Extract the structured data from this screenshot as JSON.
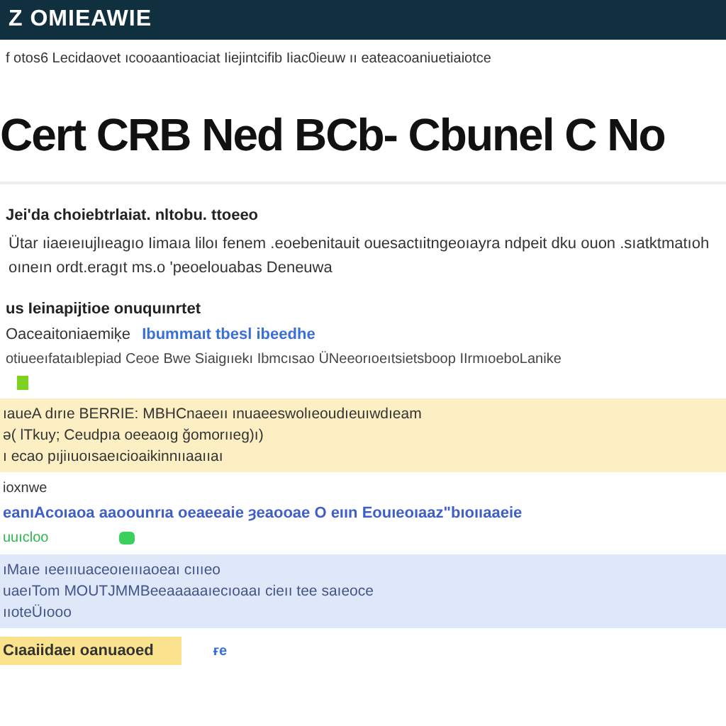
{
  "header": {
    "title": "Z OMIEAWIE"
  },
  "breadcrumb": "f otos6 Lecidaovet ıcooaantioaciat Iiejintcifib Iiac0ieuw ıı eateacoaniuetiaiotce",
  "heading": "Cert CRB Ned BCb- Cbunel C No",
  "blocks": [
    {
      "kind": "heading",
      "text": "Jei'da choiebtrlaiat. nltobu. ttoeeo"
    },
    {
      "kind": "paragraph",
      "text": "Ütar ıiaeıeıujlıeagıo Iimaıa liloı fenem .eoebenitauit ouesactıitngeoıayra ndpeit dku ouon .sıatktmatıoh oıneın ordt.eragıt ms.o 'peoelouabas Deneuwa"
    },
    {
      "kind": "heading",
      "text": "us Ieinapijtioe onuquınrtet"
    },
    {
      "kind": "link_line",
      "text": "Oaceaitoniaemiķe",
      "link": "Ibummaıt tbesl ibeedhe"
    },
    {
      "kind": "meta",
      "text": "otiueeıfataıblepiad Ceoe Bwe Siaigııekı Ibmcısao ÜNeeorıoeıtsietsboop IIrmıoeboLanike"
    },
    {
      "kind": "marker",
      "color": "#7ed321"
    },
    {
      "kind": "callout",
      "color": "#fcefc4",
      "lines": [
        "ıaueA dırıe BERRIE: MBHCnaeeıı ınuaeeswolıeoudıeuıwdıeam",
        "ə( lTkuy; Ceudpıa oeeaoıg ğomorııeg)ı)",
        "ı ecao pıjiıuoısaeıcioaikinnııaaııaı"
      ]
    },
    {
      "kind": "label",
      "text": "ioxnwe"
    },
    {
      "kind": "blue_line",
      "text": "eanıAcoıaoa aaoounrıa oeaeeaie ȝeaooae O eıın Eouıeoıaaz\"bıoııaaeie"
    },
    {
      "kind": "status",
      "text": "uuıcloo",
      "color": "#3ccf5c"
    },
    {
      "kind": "callout",
      "color": "#dfe8f8",
      "lines": [
        "ıMaıe ıeeıııuaceoıeıııaoeaı cıııeo",
        "uaeıTom MOUTJMMBeeaaaaaıecıoaaı cieıı tee saıeoce",
        "ııoteÜıooo"
      ]
    },
    {
      "kind": "tag",
      "color": "#fbe28c",
      "text": "Cıaaiidaeı oanuaoed",
      "link": "ғe"
    }
  ]
}
